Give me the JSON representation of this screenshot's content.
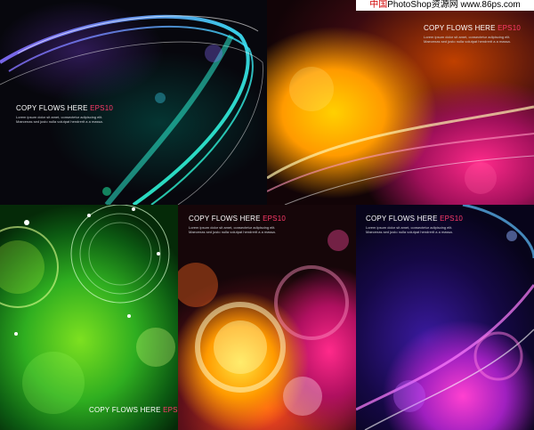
{
  "watermark": {
    "brand_cn": "中国",
    "brand_mid": "PhotoShop资源网",
    "url": "www.86ps.com"
  },
  "panels": [
    {
      "title": "COPY FLOWS HERE",
      "tag": "EPS10",
      "line1": "Lorem ipsum dolor sit amet, consectetur adipiscing elit.",
      "line2": "Maecenas sed justo nulla volutpat hendrerit a a massa."
    },
    {
      "title": "COPY FLOWS HERE",
      "tag": "EPS10",
      "line1": "Lorem ipsum dolor sit amet, consectetur adipiscing elit.",
      "line2": "Maecenas sed justo nulla volutpat hendrerit a a massa."
    },
    {
      "title": "COPY FLOWS HERE",
      "tag": "EPS10"
    },
    {
      "title": "COPY FLOWS HERE",
      "tag": "EPS10",
      "line1": "Lorem ipsum dolor sit amet, consectetur adipiscing elit.",
      "line2": "Maecenas sed justo nulla volutpat hendrerit a a massa."
    },
    {
      "title": "COPY FLOWS HERE",
      "tag": "EPS10",
      "line1": "Lorem ipsum dolor sit amet, consectetur adipiscing elit.",
      "line2": "Maecenas sed justo nulla volutpat hendrerit a a massa."
    }
  ],
  "colors": {
    "accent_eps": "#ff3a6a",
    "watermark_red": "#d00000"
  }
}
